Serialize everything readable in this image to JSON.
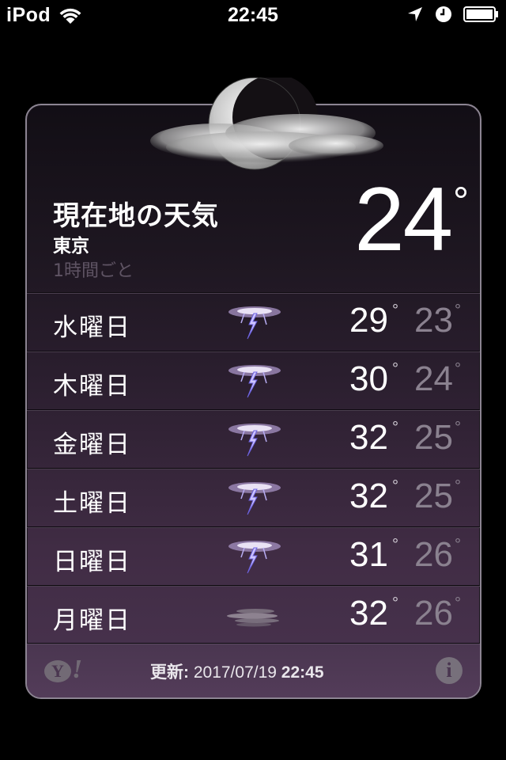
{
  "status_bar": {
    "carrier": "iPod",
    "time": "22:45",
    "icons": [
      "wifi-icon",
      "location-icon",
      "clock-icon",
      "battery-icon"
    ]
  },
  "current": {
    "title": "現在地の天気",
    "city": "東京",
    "subtitle": "1時間ごと",
    "temperature": "24",
    "degree": "°",
    "condition_icon": "moon-cloud-icon"
  },
  "forecast": [
    {
      "day": "水曜日",
      "icon": "thunderstorm-icon",
      "high": "29",
      "low": "23"
    },
    {
      "day": "木曜日",
      "icon": "thunderstorm-icon",
      "high": "30",
      "low": "24"
    },
    {
      "day": "金曜日",
      "icon": "thunderstorm-icon",
      "high": "32",
      "low": "25"
    },
    {
      "day": "土曜日",
      "icon": "thunderstorm-icon",
      "high": "32",
      "low": "25"
    },
    {
      "day": "日曜日",
      "icon": "thunderstorm-icon",
      "high": "31",
      "low": "26"
    },
    {
      "day": "月曜日",
      "icon": "fog-icon",
      "high": "32",
      "low": "26"
    }
  ],
  "degree_symbol": "°",
  "footer": {
    "logo_y": "Y",
    "logo_excl": "!",
    "updated_label": "更新:",
    "updated_date": "2017/07/19",
    "updated_time": "22:45",
    "info_label": "i"
  },
  "colors": {
    "card_top": "#120e15",
    "card_bottom": "#4a3450",
    "low_temp": "#8a818f",
    "subtitle": "#5f5464"
  }
}
